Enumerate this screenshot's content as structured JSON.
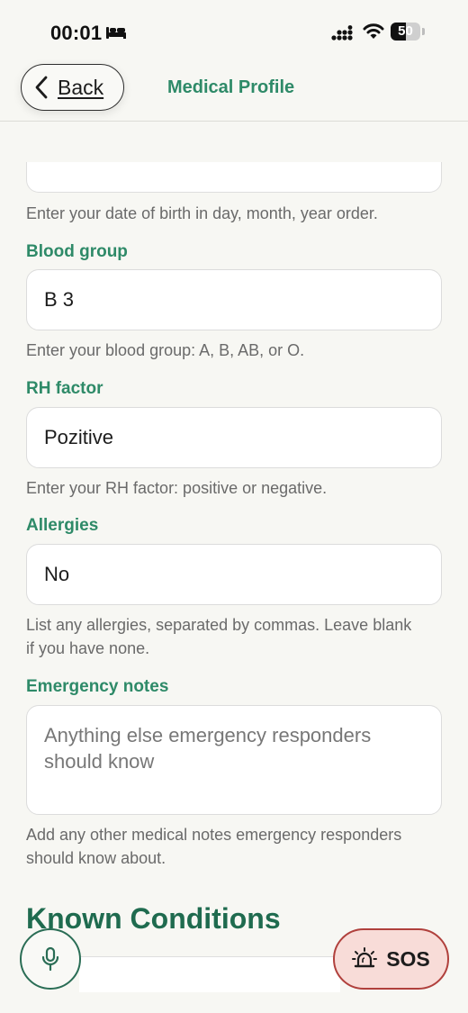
{
  "status_bar": {
    "time": "00:01",
    "battery_level": "50",
    "battery_fraction": 0.5,
    "icons": [
      "bed-icon",
      "signal-icon",
      "wifi-icon",
      "battery-icon"
    ]
  },
  "header": {
    "back_label": "Back",
    "title": "Medical Profile"
  },
  "form": {
    "dob_help": "Enter your date of birth in day, month, year order.",
    "blood_group": {
      "label": "Blood group",
      "value": "B 3",
      "help": "Enter your blood group: A, B, AB, or O."
    },
    "rh_factor": {
      "label": "RH factor",
      "value": "Pozitive",
      "help": "Enter your RH factor: positive or negative."
    },
    "allergies": {
      "label": "Allergies",
      "value": "No",
      "help": "List any allergies, separated by commas. Leave blank if you have none."
    },
    "emergency_notes": {
      "label": "Emergency notes",
      "placeholder": "Anything else emergency responders should know",
      "value": "",
      "help": "Add any other medical notes emergency responders should know about."
    }
  },
  "known_conditions": {
    "heading": "Known Conditions"
  },
  "floating": {
    "mic_icon": "microphone-icon",
    "sos_label": "SOS",
    "sos_icon": "siren-icon"
  },
  "colors": {
    "accent_green": "#2e8a68",
    "heading_green": "#1f6b4f",
    "background": "#f7f7f3",
    "sos_fill": "#f8dcd8",
    "sos_border": "#b0403c"
  }
}
